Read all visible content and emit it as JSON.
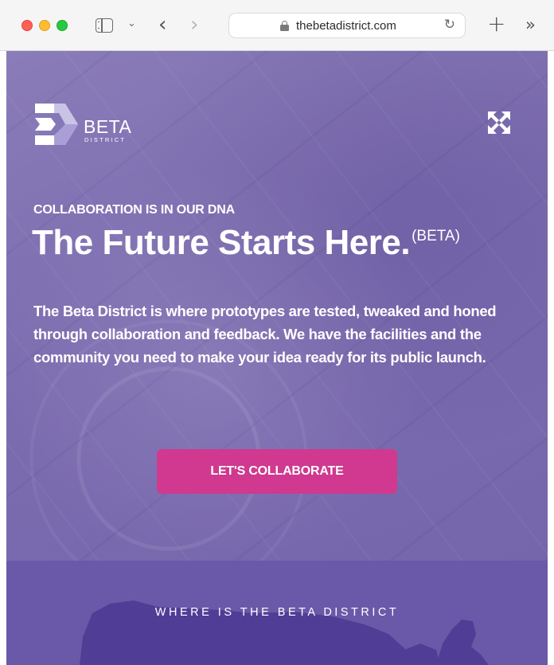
{
  "browser": {
    "url": "thebetadistrict.com"
  },
  "brand": {
    "name": "BETA",
    "sub": "DISTRICT"
  },
  "hero": {
    "eyebrow": "COLLABORATION IS IN OUR DNA",
    "headline": "The Future Starts Here.",
    "headline_sup": "(BETA)",
    "intro": "The Beta District is where prototypes are tested, tweaked and honed through collaboration and feedback. We have the facilities and the community you need to make your idea ready for its public launch.",
    "cta_label": "LET'S COLLABORATE"
  },
  "location": {
    "title": "WHERE IS THE BETA DISTRICT"
  },
  "colors": {
    "hero_purple": "#7c6db0",
    "cta_pink": "#d0398f",
    "location_purple": "#6a59a8",
    "map_purple": "#4f3d96"
  }
}
